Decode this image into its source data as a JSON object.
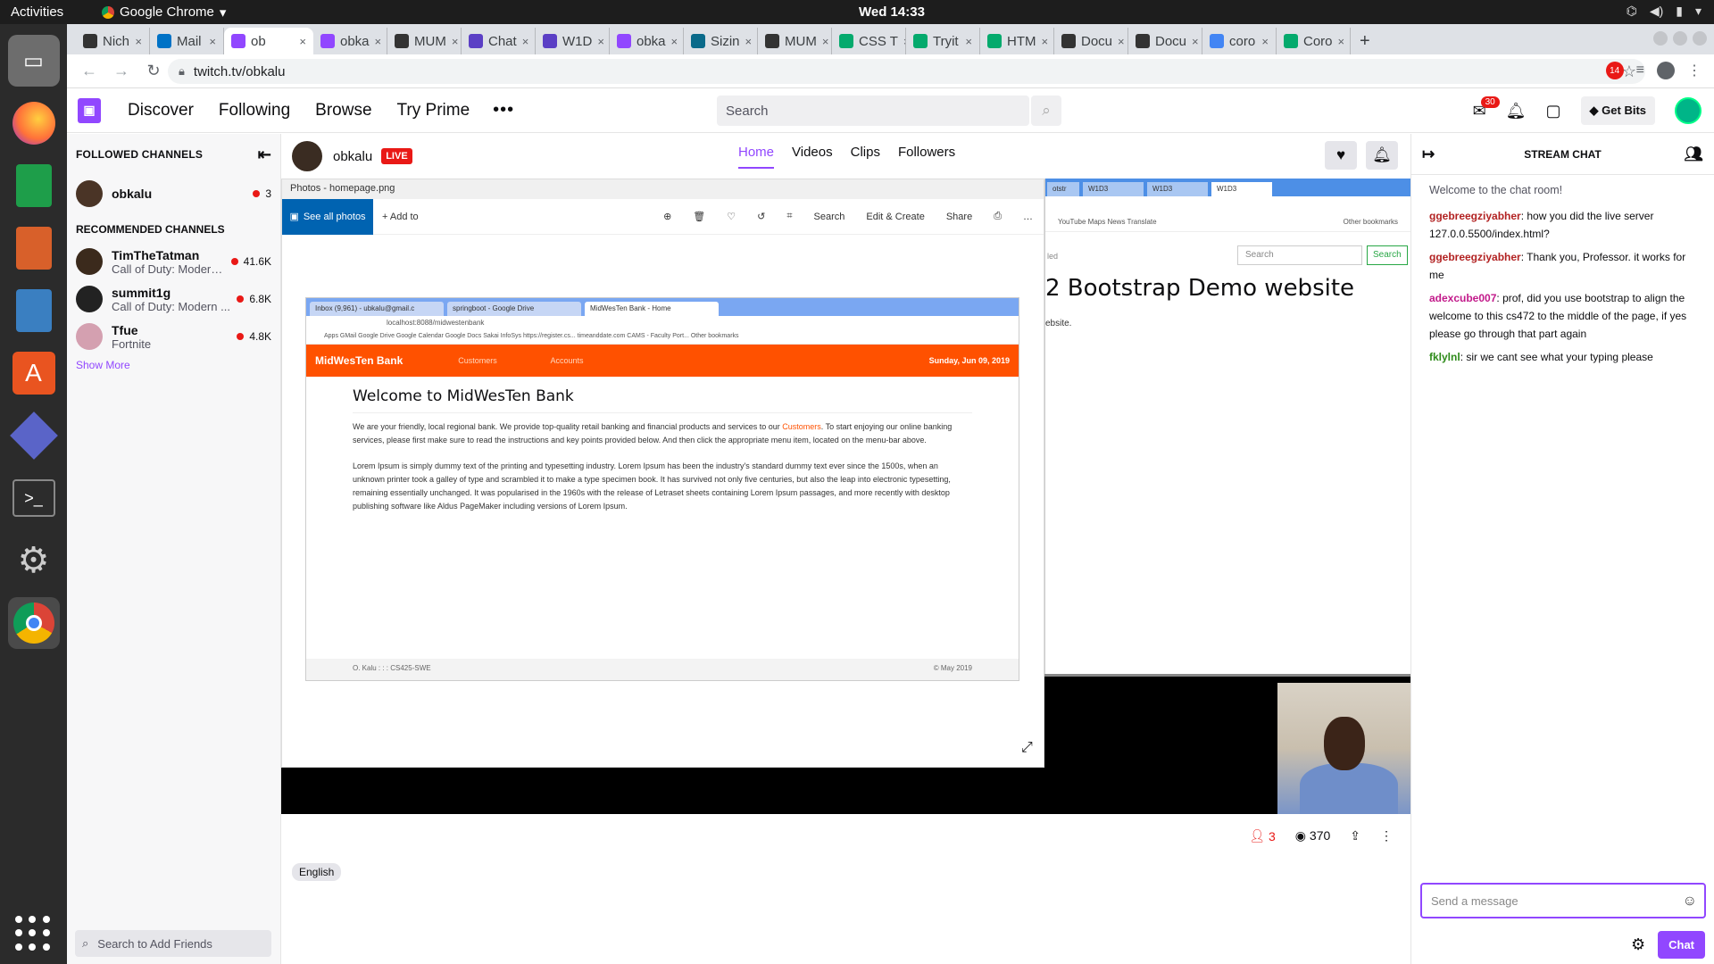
{
  "os": {
    "activities": "Activities",
    "app_name": "Google Chrome",
    "clock": "Wed 14:33"
  },
  "browser": {
    "tabs": [
      {
        "label": "Nich",
        "icon": "github-icon",
        "color": "#333333"
      },
      {
        "label": "Mail",
        "icon": "outlook-icon",
        "color": "#0072c6"
      },
      {
        "label": "ob",
        "icon": "twitch-icon",
        "color": "#9147ff"
      },
      {
        "label": "obka",
        "icon": "twitch-icon",
        "color": "#9147ff"
      },
      {
        "label": "MUM",
        "icon": "github-icon",
        "color": "#333333"
      },
      {
        "label": "Chat",
        "icon": "teams-icon",
        "color": "#5b3fc5"
      },
      {
        "label": "W1D",
        "icon": "teams-icon",
        "color": "#5b3fc5"
      },
      {
        "label": "obka",
        "icon": "twitch-icon",
        "color": "#9147ff"
      },
      {
        "label": "Sizin",
        "icon": "site-icon",
        "color": "#0a6a8a"
      },
      {
        "label": "MUM",
        "icon": "github-icon",
        "color": "#333333"
      },
      {
        "label": "CSS T",
        "icon": "w3-icon",
        "color": "#04aa6d"
      },
      {
        "label": "Tryit",
        "icon": "w3-icon",
        "color": "#04aa6d"
      },
      {
        "label": "HTM",
        "icon": "w3-icon",
        "color": "#04aa6d"
      },
      {
        "label": "Docu",
        "icon": "github-icon",
        "color": "#333333"
      },
      {
        "label": "Docu",
        "icon": "github-icon",
        "color": "#333333"
      },
      {
        "label": "coro",
        "icon": "google-icon",
        "color": "#4285f4"
      },
      {
        "label": "Coro",
        "icon": "w3-icon",
        "color": "#04aa6d"
      }
    ],
    "url": "twitch.tv/obkalu",
    "extension_badge": "14"
  },
  "twitch": {
    "nav": [
      "Discover",
      "Following",
      "Browse",
      "Try Prime"
    ],
    "search_placeholder": "Search",
    "inbox_count": "30",
    "get_bits": "Get Bits",
    "followed_header": "FOLLOWED CHANNELS",
    "followed": [
      {
        "name": "obkalu",
        "viewers": "3",
        "avatar_color": "#4a3426"
      }
    ],
    "recommended_header": "RECOMMENDED CHANNELS",
    "recommended": [
      {
        "name": "TimTheTatman",
        "game": "Call of Duty: Modern...",
        "viewers": "41.6K",
        "avatar_color": "#3b2a1c"
      },
      {
        "name": "summit1g",
        "game": "Call of Duty: Modern ...",
        "viewers": "6.8K",
        "avatar_color": "#222222"
      },
      {
        "name": "Tfue",
        "game": "Fortnite",
        "viewers": "4.8K",
        "avatar_color": "#d4a0b0"
      }
    ],
    "show_more": "Show More",
    "friends_placeholder": "Search to Add Friends",
    "channel": {
      "name": "obkalu",
      "live": "LIVE",
      "tabs": [
        "Home",
        "Videos",
        "Clips",
        "Followers"
      ]
    },
    "stats": {
      "viewers": "3",
      "views": "370"
    },
    "language": "English"
  },
  "stream": {
    "photos_title": "Photos - homepage.png",
    "see_all": "See all photos",
    "add_to": "Add to",
    "tools": [
      "Search",
      "Edit & Create",
      "Share"
    ],
    "inner_tabs": [
      "Inbox (9,961) - ubkalu@gmail.c",
      "springboot - Google Drive",
      "MidWesTen Bank - Home"
    ],
    "inner_url": "localhost:8088/midwestenbank",
    "inner_bookmarks": "Apps   GMail   Google Drive   Google Calendar   Google Docs   Sakai   InfoSys   https://register.cs...   timeanddate.com   CAMS - Faculty Port...   Other bookmarks",
    "bank_name": "MidWesTen Bank",
    "bank_tabs": [
      "Customers",
      "Accounts"
    ],
    "bank_date": "Sunday, Jun 09, 2019",
    "bank_heading": "Welcome to MidWesTen Bank",
    "bank_para1_a": "We are your friendly, local regional bank. We provide top-quality retail banking and financial products and services to our ",
    "bank_para1_link": "Customers",
    "bank_para1_b": ". To start enjoying our online banking services, please first make sure to read the instructions and key points provided below. And then click the appropriate menu item, located on the menu-bar above.",
    "bank_para2": "Lorem Ipsum is simply dummy text of the printing and typesetting industry. Lorem Ipsum has been the industry's standard dummy text ever since the 1500s, when an unknown printer took a galley of type and scrambled it to make a type specimen book. It has survived not only five centuries, but also the leap into electronic typesetting, remaining essentially unchanged. It was popularised in the 1960s with the release of Letraset sheets containing Lorem Ipsum passages, and more recently with desktop publishing software like Aldus PageMaker including versions of Lorem Ipsum.",
    "bank_footer_left": "O. Kalu : : : CS425-SWE",
    "bank_footer_right": "© May 2019",
    "right_tabs": [
      "otstr",
      "W1D3",
      "W1D3",
      "W1D3"
    ],
    "right_bookmarks": "YouTube   Maps   News   Translate",
    "right_other": "Other bookmarks",
    "right_search": "Search",
    "right_search_btn": "Search",
    "right_led": "led",
    "right_heading": "2 Bootstrap Demo website",
    "right_sub": "ebsite."
  },
  "chat": {
    "title": "STREAM CHAT",
    "welcome": "Welcome to the chat room!",
    "messages": [
      {
        "user": "ggebreegziyabher",
        "color": "#b22222",
        "text": "how you did the live server 127.0.0.5500/index.html?"
      },
      {
        "user": "ggebreegziyabher",
        "color": "#b22222",
        "text": "Thank you, Professor. it works for me"
      },
      {
        "user": "adexcube007",
        "color": "#c21a8a",
        "text": "prof, did you use bootstrap to align the welcome to this cs472 to the middle of the page, if yes please go through that part again"
      },
      {
        "user": "fklylnl",
        "color": "#2e8b1a",
        "text": "sir we cant see what your typing please"
      }
    ],
    "input_placeholder": "Send a message",
    "send_label": "Chat"
  }
}
